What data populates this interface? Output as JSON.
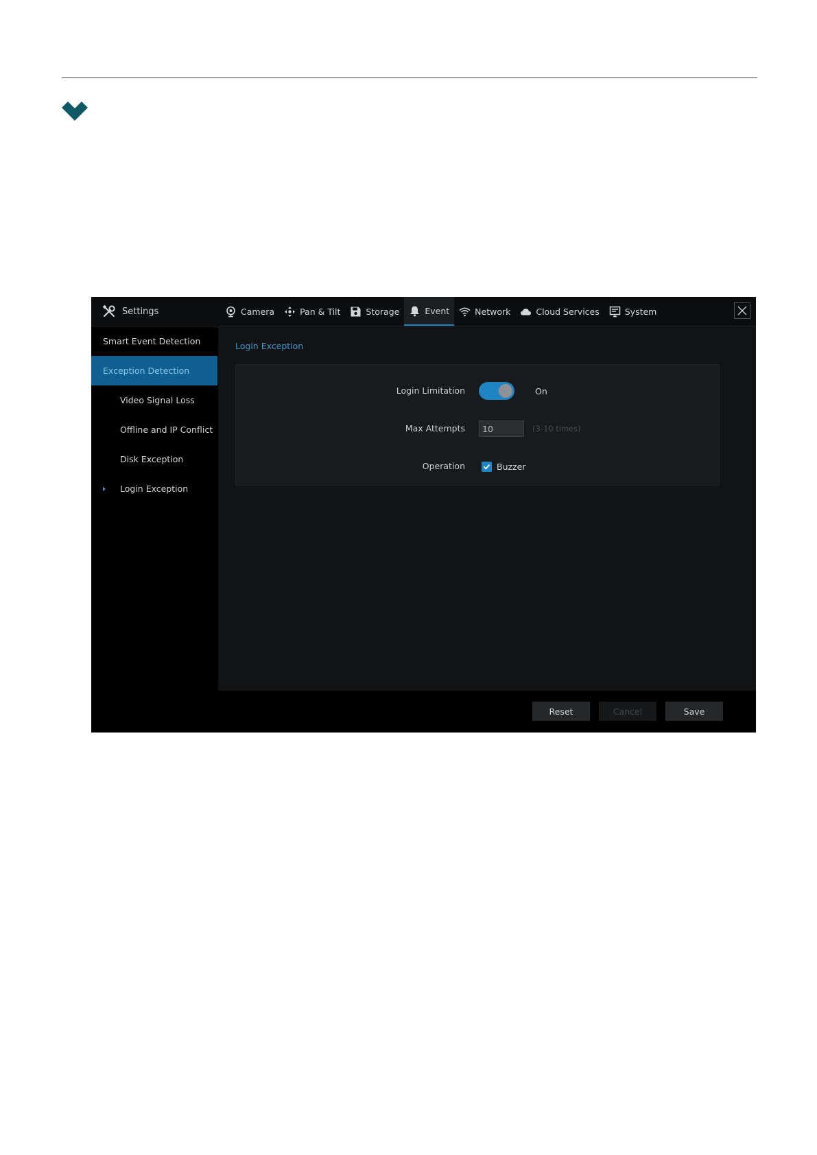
{
  "app": {
    "brand_label": "Settings",
    "tabs": [
      {
        "label": "Camera",
        "icon": "camera-icon"
      },
      {
        "label": "Pan & Tilt",
        "icon": "pan-tilt-icon"
      },
      {
        "label": "Storage",
        "icon": "storage-icon"
      },
      {
        "label": "Event",
        "icon": "bell-icon",
        "active": true
      },
      {
        "label": "Network",
        "icon": "wifi-icon"
      },
      {
        "label": "Cloud Services",
        "icon": "cloud-icon"
      },
      {
        "label": "System",
        "icon": "system-icon"
      }
    ]
  },
  "sidebar": {
    "items": [
      {
        "label": "Smart Event Detection"
      },
      {
        "label": "Exception Detection",
        "active": true
      },
      {
        "label": "Video Signal Loss"
      },
      {
        "label": "Offline and IP Conflict"
      },
      {
        "label": "Disk Exception"
      },
      {
        "label": "Login Exception",
        "current": true
      }
    ]
  },
  "main": {
    "section_title": "Login Exception",
    "login_limitation": {
      "label": "Login Limitation",
      "state": "On",
      "enabled": true
    },
    "max_attempts": {
      "label": "Max Attempts",
      "value": "10",
      "hint": "(3-10 times)"
    },
    "operation": {
      "label": "Operation",
      "option": "Buzzer",
      "checked": true
    }
  },
  "footer": {
    "reset_label": "Reset",
    "cancel_label": "Cancel",
    "save_label": "Save"
  },
  "colors": {
    "accent": "#1f84c4",
    "brand_chevron": "#0d5a66",
    "background": "#000000"
  }
}
